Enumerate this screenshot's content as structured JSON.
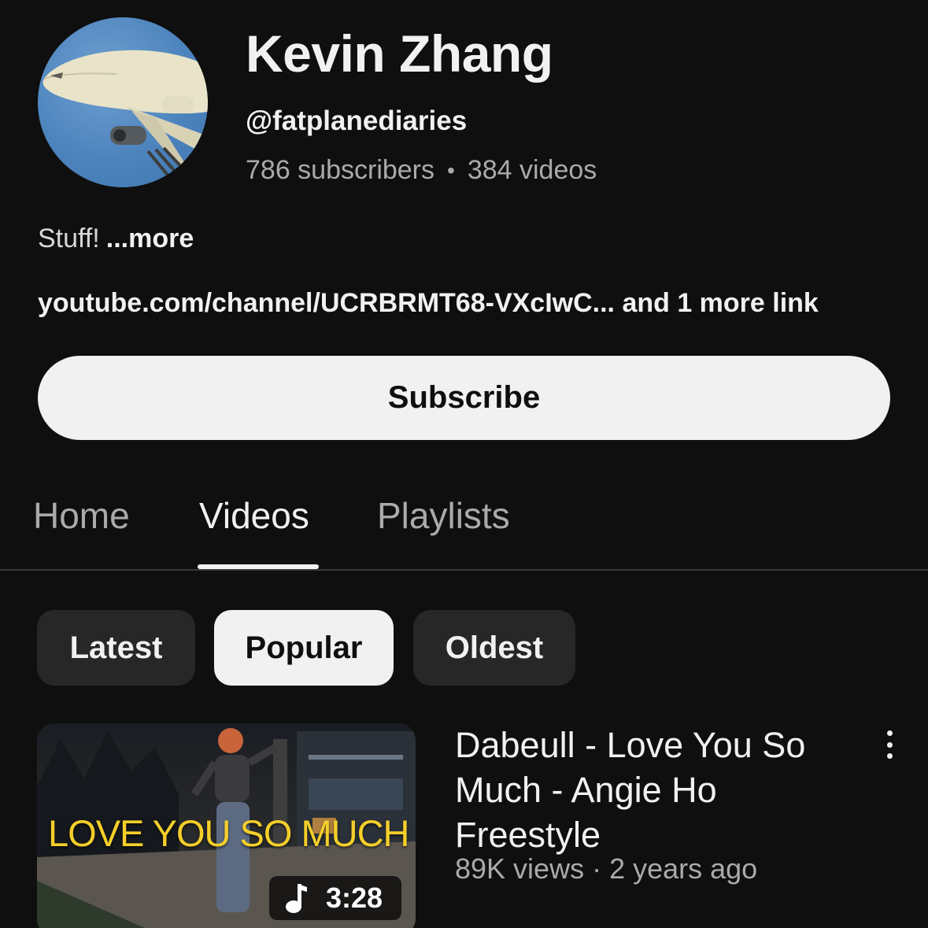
{
  "channel": {
    "name": "Kevin Zhang",
    "handle": "@fatplanediaries",
    "subscribers": "786 subscribers",
    "separator": "•",
    "videos": "384 videos",
    "description": "Stuff!",
    "more_label": "...more",
    "links_text": "youtube.com/channel/UCRBRMT68-VXcIwC... and 1 more link",
    "avatar_icon": "airplane-avatar"
  },
  "subscribe_label": "Subscribe",
  "tabs": [
    {
      "label": "Home",
      "active": false
    },
    {
      "label": "Videos",
      "active": true
    },
    {
      "label": "Playlists",
      "active": false
    }
  ],
  "chips": [
    {
      "label": "Latest",
      "selected": false
    },
    {
      "label": "Popular",
      "selected": true
    },
    {
      "label": "Oldest",
      "selected": false
    }
  ],
  "video": {
    "thumbnail_text": "LOVE YOU SO MUCH",
    "duration": "3:28",
    "duration_icon": "music-note-icon",
    "title": "Dabeull - Love You So Much - Angie Ho Freestyle",
    "meta": "89K views · 2 years ago"
  },
  "colors": {
    "background": "#0f0f0f",
    "primary_text": "#f1f1f1",
    "secondary_text": "#aaaaaa",
    "chip_bg": "#272727",
    "thumbnail_text": "#f5cf2a"
  }
}
